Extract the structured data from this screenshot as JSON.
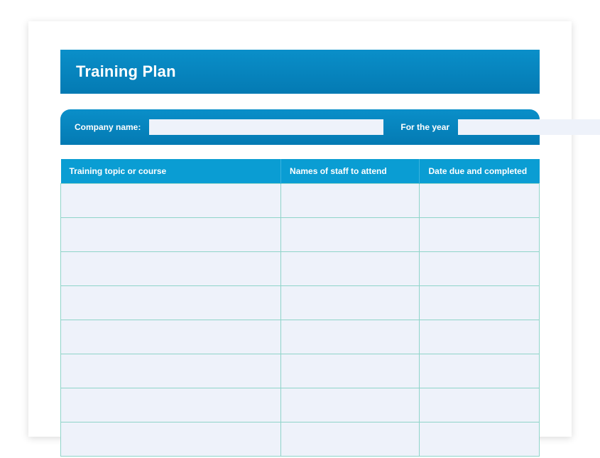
{
  "title": "Training Plan",
  "info": {
    "company_label": "Company name:",
    "company_value": "",
    "year_label": "For the year",
    "year_value": ""
  },
  "table": {
    "headers": {
      "topic": "Training topic or course",
      "staff": "Names of staff to attend",
      "date": "Date due and completed"
    },
    "rows": [
      {
        "topic": "",
        "staff": "",
        "date": ""
      },
      {
        "topic": "",
        "staff": "",
        "date": ""
      },
      {
        "topic": "",
        "staff": "",
        "date": ""
      },
      {
        "topic": "",
        "staff": "",
        "date": ""
      },
      {
        "topic": "",
        "staff": "",
        "date": ""
      },
      {
        "topic": "",
        "staff": "",
        "date": ""
      },
      {
        "topic": "",
        "staff": "",
        "date": ""
      },
      {
        "topic": "",
        "staff": "",
        "date": ""
      }
    ]
  }
}
